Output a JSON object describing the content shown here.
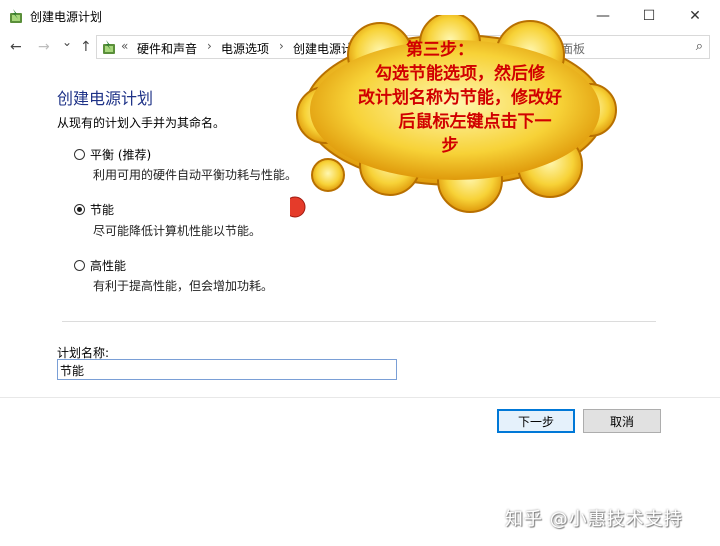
{
  "window": {
    "title": "创建电源计划",
    "minimize_icon": "—",
    "maximize_icon": "☐",
    "close_icon": "✕"
  },
  "nav": {
    "back_icon": "←",
    "forward_icon": "→",
    "dropdown_icon": "⌄",
    "up_icon": "↑"
  },
  "address": {
    "overflow": "«",
    "crumbs": [
      "硬件和声音",
      "电源选项",
      "创建电源计"
    ],
    "separator": "›"
  },
  "search": {
    "placeholder": "控制面板",
    "icon": "⌕"
  },
  "main": {
    "heading": "创建电源计划",
    "subtitle": "从现有的计划入手并为其命名。",
    "options": [
      {
        "label": "平衡 (推荐)",
        "desc": "利用可用的硬件自动平衡功耗与性能。",
        "checked": false
      },
      {
        "label": "节能",
        "desc": "尽可能降低计算机性能以节能。",
        "checked": true
      },
      {
        "label": "高性能",
        "desc": "有利于提高性能，但会增加功耗。",
        "checked": false
      }
    ],
    "plan_name_label": "计划名称:",
    "plan_name_value": "节能"
  },
  "buttons": {
    "next": "下一步",
    "cancel": "取消"
  },
  "callout": {
    "lines": [
      "第三步：",
      "勾选节能选项，然后修",
      "改计划名称为节能，修改好",
      "后鼠标左键点击下一",
      "步"
    ]
  },
  "watermark": "知乎 @小惠技术支持",
  "colors": {
    "heading": "#1e3287",
    "callout_text": "#d10000",
    "callout_fill": "#f7d237",
    "primary_border": "#0078d7"
  }
}
